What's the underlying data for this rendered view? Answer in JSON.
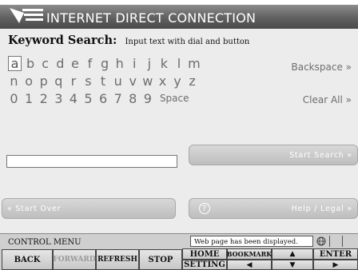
{
  "header": {
    "title": "INTERNET DIRECT CONNECTION"
  },
  "keyword_search": {
    "title": "Keyword Search:",
    "hint": "Input text with dial and button"
  },
  "keyboard": {
    "row1": [
      "a",
      "b",
      "c",
      "d",
      "e",
      "f",
      "g",
      "h",
      "i",
      "j",
      "k",
      "l",
      "m"
    ],
    "row2": [
      "n",
      "o",
      "p",
      "q",
      "r",
      "s",
      "t",
      "u",
      "v",
      "w",
      "x",
      "y",
      "z"
    ],
    "row3": [
      "0",
      "1",
      "2",
      "3",
      "4",
      "5",
      "6",
      "7",
      "8",
      "9"
    ],
    "space_label": "Space",
    "selected": "a",
    "backspace_label": "Backspace »",
    "clear_all_label": "Clear All »"
  },
  "search": {
    "input_value": "",
    "start_search_label": "Start Search »",
    "start_over_label": "« Start Over",
    "help_legal_label": "Help / Legal »"
  },
  "control_menu": {
    "label": "CONTROL MENU",
    "status_text": "Web page has been displayed.",
    "buttons": {
      "back": "BACK",
      "forward": "FORWARD",
      "refresh": "REFRESH",
      "stop": "STOP",
      "home": "HOME",
      "setting": "SETTING",
      "bookmark": "BOOKMARK",
      "enter": "ENTER"
    }
  },
  "colors": {
    "header_band": "#606060",
    "button_face": "#c4c4c4",
    "key_text": "#6d6d6d"
  }
}
